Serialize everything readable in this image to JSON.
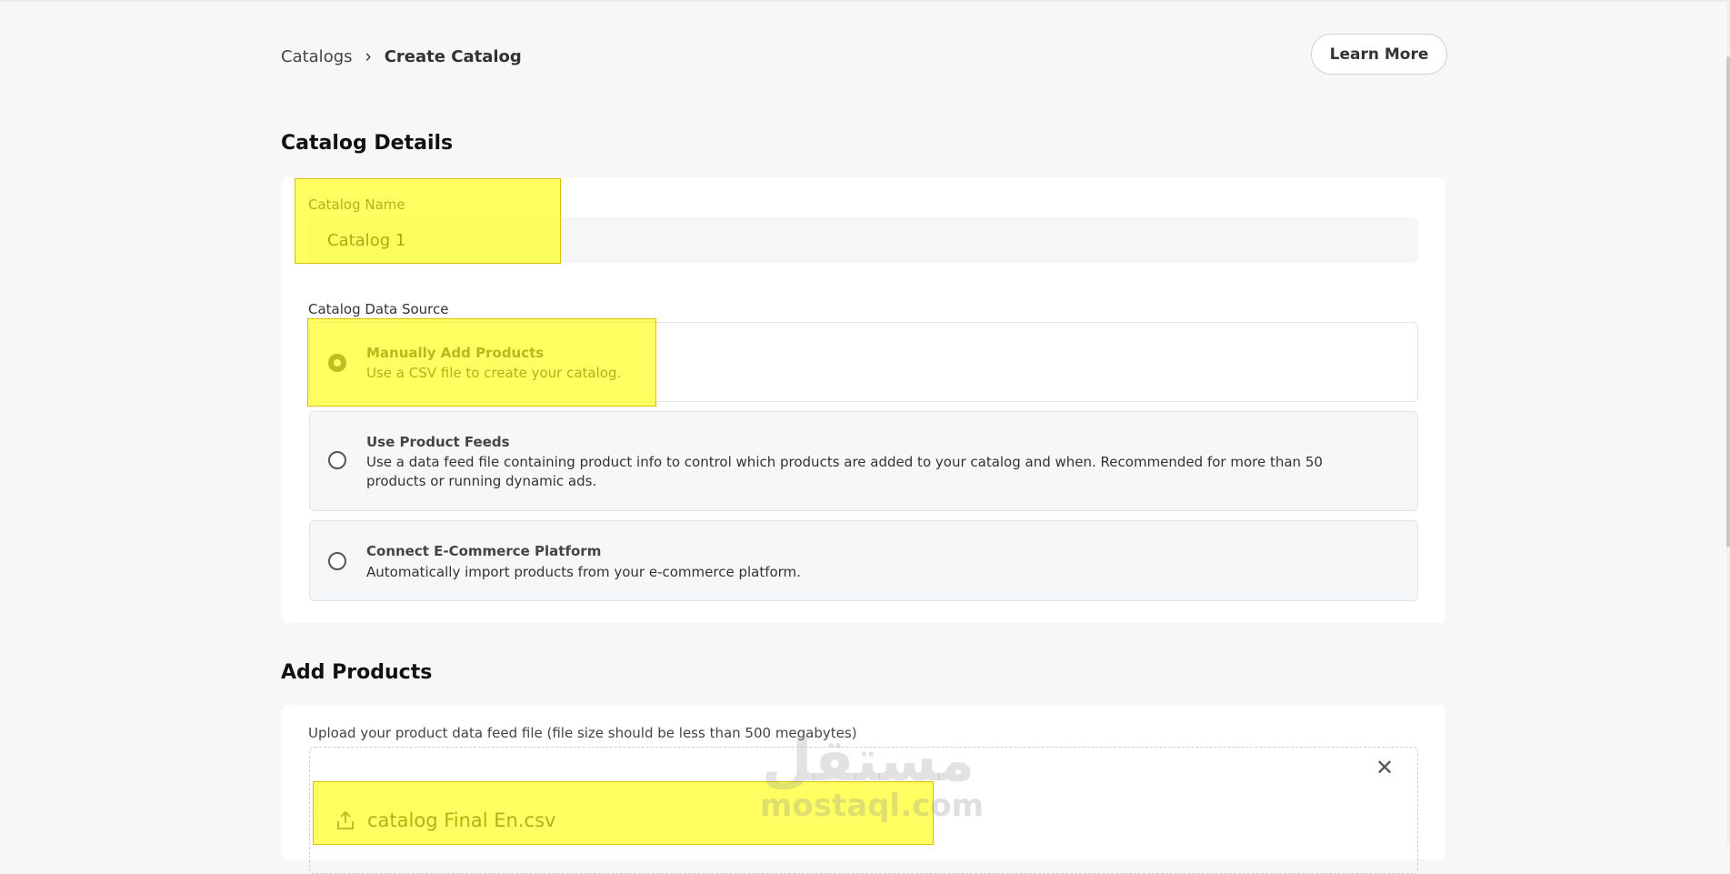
{
  "breadcrumb": {
    "parent": "Catalogs",
    "current": "Create Catalog",
    "separator": "chevron-right-icon"
  },
  "header": {
    "learn_more_label": "Learn More"
  },
  "catalog_details": {
    "title": "Catalog Details",
    "name_label": "Catalog Name",
    "name_value": "Catalog 1",
    "source_label": "Catalog Data Source",
    "options": [
      {
        "title": "Manually Add Products",
        "description": "Use a CSV file to create your catalog.",
        "selected": true
      },
      {
        "title": "Use Product Feeds",
        "description": "Use a data feed file containing product info to control which products are added to your catalog and when. Recommended for more than 50 products or running dynamic ads.",
        "selected": false
      },
      {
        "title": "Connect E-Commerce Platform",
        "description": "Automatically import products from your e-commerce platform.",
        "selected": false
      }
    ]
  },
  "add_products": {
    "title": "Add Products",
    "upload_label": "Upload your product data feed file (file size should be less than 500 megabytes)",
    "file_name": "catalog Final En.csv",
    "file_icon": "upload-icon",
    "remove_icon": "close-icon"
  },
  "watermark": {
    "arabic": "مستقل",
    "latin": "mostaql.com"
  },
  "colors": {
    "highlight": "#ffff00",
    "background": "#f7f7f7",
    "card": "#ffffff"
  }
}
